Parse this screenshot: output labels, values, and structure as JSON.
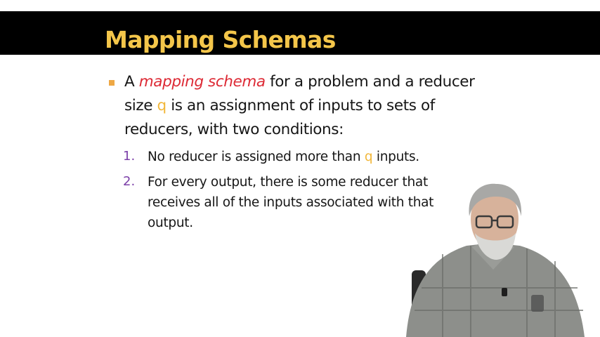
{
  "slide": {
    "title": "Mapping Schemas",
    "bullet": {
      "part1": "A ",
      "emphasis": "mapping schema",
      "part2": " for a problem and a reducer",
      "part3": "size ",
      "var": "q",
      "part4": " is an assignment of inputs to sets of",
      "part5": "reducers, with two conditions:"
    },
    "conditions": [
      {
        "number": "1.",
        "before": "No reducer is assigned more than ",
        "var": "q",
        "after": " inputs."
      },
      {
        "number": "2.",
        "line1": "For every output, there is some reducer that",
        "line2": "receives all of the inputs associated with that",
        "line3": "output."
      }
    ]
  },
  "colors": {
    "title": "#f4c64a",
    "title_bar": "#000000",
    "bullet_square": "#eea845",
    "emphasis": "#dd2a35",
    "variable": "#f2b73a",
    "list_number": "#7b3fa8"
  }
}
